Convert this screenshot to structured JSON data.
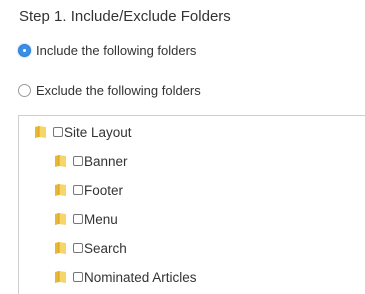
{
  "step": {
    "title": "Step 1. Include/Exclude Folders"
  },
  "mode_options": [
    {
      "label": "Include the following folders",
      "selected": true
    },
    {
      "label": "Exclude the following folders",
      "selected": false
    }
  ],
  "folder_tree": {
    "root": {
      "label": "Site Layout",
      "checked": false,
      "icon": "folder-icon"
    },
    "children": [
      {
        "label": "Banner",
        "checked": false,
        "icon": "folder-icon"
      },
      {
        "label": "Footer",
        "checked": false,
        "icon": "folder-icon"
      },
      {
        "label": "Menu",
        "checked": false,
        "icon": "folder-icon"
      },
      {
        "label": "Search",
        "checked": false,
        "icon": "folder-icon"
      },
      {
        "label": "Nominated Articles",
        "checked": false,
        "icon": "folder-icon"
      }
    ]
  },
  "colors": {
    "radio_selected": "#3a8ee6",
    "folder_yellow": "#f2c94c",
    "text": "#333333",
    "border": "#cfcfcf"
  }
}
